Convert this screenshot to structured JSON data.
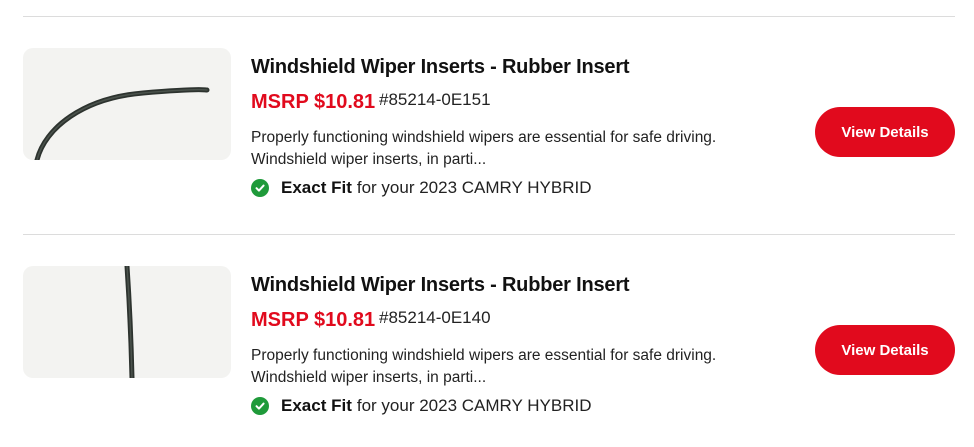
{
  "products": [
    {
      "title": "Windshield Wiper Inserts - Rubber Insert",
      "price": "MSRP $10.81",
      "part_number": "#85214-0E151",
      "description_line1": "Properly functioning windshield wipers are essential for safe driving.",
      "description_line2": "Windshield wiper inserts, in parti...",
      "fit_bold": "Exact Fit",
      "fit_text": "for your 2023 CAMRY HYBRID",
      "button_label": "View Details",
      "image_icon": "wiper-insert-curved-image"
    },
    {
      "title": "Windshield Wiper Inserts - Rubber Insert",
      "price": "MSRP $10.81",
      "part_number": "#85214-0E140",
      "description_line1": "Properly functioning windshield wipers are essential for safe driving.",
      "description_line2": "Windshield wiper inserts, in parti...",
      "fit_bold": "Exact Fit",
      "fit_text": "for your 2023 CAMRY HYBRID",
      "button_label": "View Details",
      "image_icon": "wiper-insert-straight-image"
    }
  ],
  "colors": {
    "accent_red": "#e10a1d",
    "check_green": "#1f9a3a",
    "divider": "#dcdcdc"
  }
}
